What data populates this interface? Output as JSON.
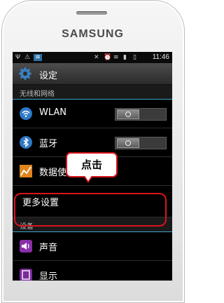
{
  "device": {
    "brand": "SAMSUNG"
  },
  "statusbar": {
    "time": "11:46"
  },
  "title": "设定",
  "sections": {
    "wireless": "无线和网络",
    "device": "设备"
  },
  "items": {
    "wlan": "WLAN",
    "bluetooth": "蓝牙",
    "data_usage": "数据使用",
    "more_settings": "更多设置",
    "sound": "声音",
    "display": "显示"
  },
  "annotation": {
    "callout": "点击"
  },
  "colors": {
    "accent": "#3aa5ce",
    "annotation": "#d8141b"
  },
  "icons": {
    "settings": "gear-icon",
    "wlan": "wifi-icon",
    "bluetooth": "bluetooth-icon",
    "data_usage": "chart-icon",
    "sound": "speaker-icon",
    "display": "display-icon"
  }
}
